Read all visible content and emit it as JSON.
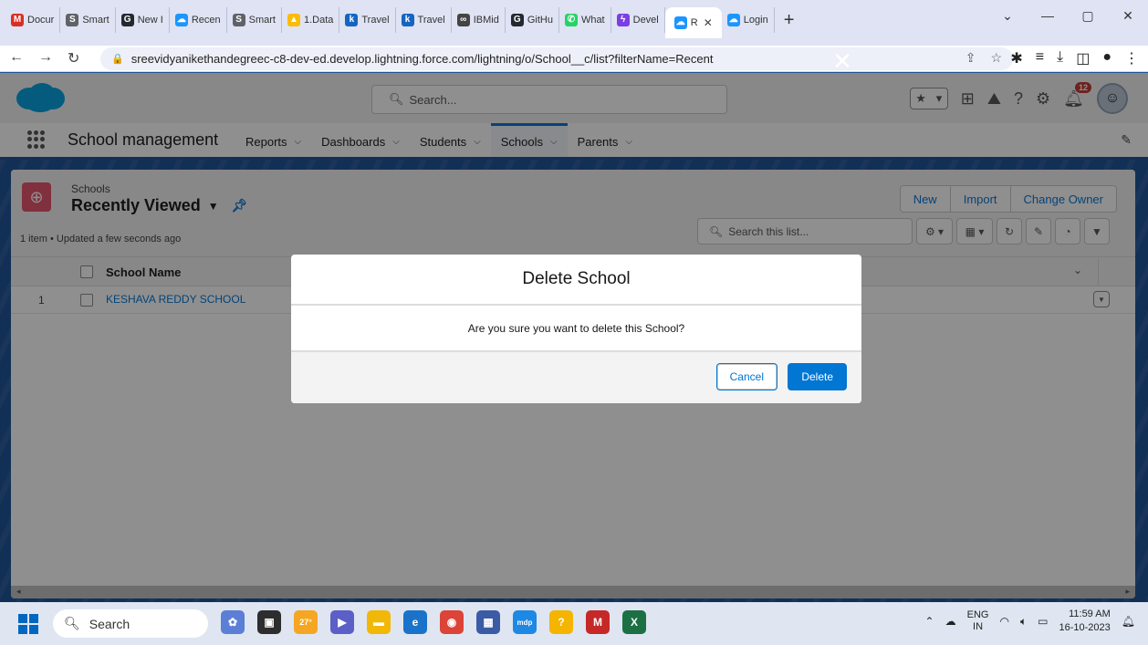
{
  "browser": {
    "tabs": [
      {
        "label": "Docur",
        "color": "#d93025",
        "glyph": "M"
      },
      {
        "label": "Smart",
        "color": "#5f6368",
        "glyph": "S"
      },
      {
        "label": "New I",
        "color": "#24292f",
        "glyph": "G"
      },
      {
        "label": "Recen",
        "color": "#1b96ff",
        "glyph": "☁"
      },
      {
        "label": "Smart",
        "color": "#5f6368",
        "glyph": "S"
      },
      {
        "label": "1.Data",
        "color": "#fbbc04",
        "glyph": "▲"
      },
      {
        "label": "Travel",
        "color": "#1565c0",
        "glyph": "k"
      },
      {
        "label": "Travel",
        "color": "#1565c0",
        "glyph": "k"
      },
      {
        "label": "IBMid",
        "color": "#444444",
        "glyph": "∞"
      },
      {
        "label": "GitHu",
        "color": "#24292f",
        "glyph": "G"
      },
      {
        "label": "What",
        "color": "#25d366",
        "glyph": "✆"
      },
      {
        "label": "Devel",
        "color": "#7b3fe4",
        "glyph": "ϟ"
      }
    ],
    "active_tab": {
      "label": "R",
      "close": "✕"
    },
    "after_tab": {
      "label": "Login"
    },
    "new_tab": "+",
    "window_controls": {
      "chevron": "⌄",
      "minimize": "—",
      "restore": "▢",
      "close": "✕"
    },
    "url": "sreevidyanikethandegreec-c8-dev-ed.develop.lightning.force.com/lightning/o/School__c/list?filterName=Recent"
  },
  "sf": {
    "search_placeholder": "Search...",
    "notification_count": "12",
    "app_name": "School management",
    "nav": [
      {
        "label": "Reports",
        "active": false
      },
      {
        "label": "Dashboards",
        "active": false
      },
      {
        "label": "Students",
        "active": false
      },
      {
        "label": "Schools",
        "active": true
      },
      {
        "label": "Parents",
        "active": false
      }
    ]
  },
  "list": {
    "object_label": "Schools",
    "title": "Recently Viewed",
    "meta": "1 item • Updated a few seconds ago",
    "buttons": [
      "New",
      "Import",
      "Change Owner"
    ],
    "search_placeholder": "Search this list...",
    "column": "School Name",
    "rows": [
      {
        "num": "1",
        "name": "KESHAVA REDDY SCHOOL"
      }
    ]
  },
  "modal": {
    "title": "Delete School",
    "message": "Are you sure you want to delete this School?",
    "cancel": "Cancel",
    "delete": "Delete"
  },
  "taskbar": {
    "search": "Search",
    "weather": "27°",
    "lang_top": "ENG",
    "lang_bottom": "IN",
    "time": "11:59 AM",
    "date": "16-10-2023"
  },
  "colors": {
    "brand": "#0176d3",
    "header_band": "#1b5297",
    "object_icon": "#e3526c"
  }
}
